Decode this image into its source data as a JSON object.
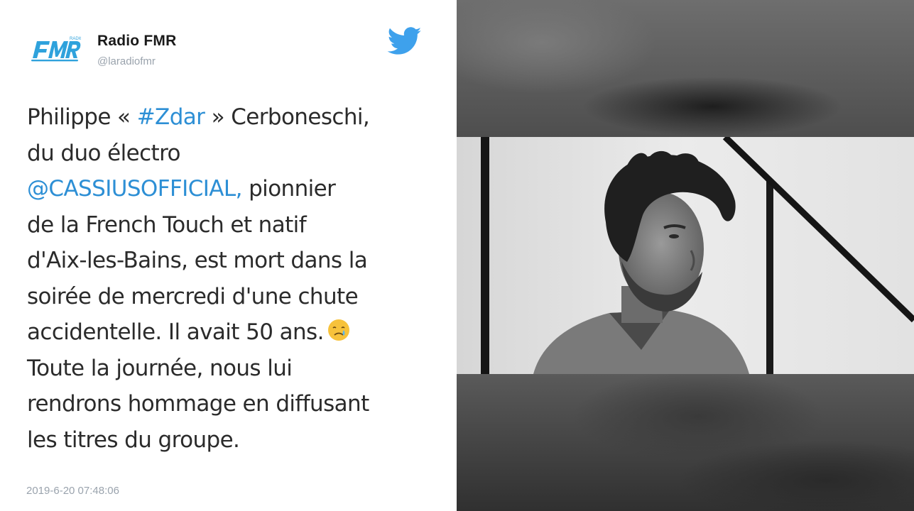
{
  "tweet": {
    "account_name": "Radio FMR",
    "handle": "@laradiofmr",
    "logo_text": "FMR",
    "text_parts": [
      {
        "text": "Philippe « ",
        "link": false
      },
      {
        "text": "#Zdar",
        "link": true
      },
      {
        "text": " » Cerboneschi,\ndu duo électro\n",
        "link": false
      },
      {
        "text": "@CASSIUSOFFICIAL,",
        "link": true
      },
      {
        "text": " pionnier\nde la French Touch et natif\nd'Aix-les-Bains, est mort dans la\nsoirée de mercredi d'une chute\naccidentelle. Il avait 50 ans.",
        "link": false
      }
    ],
    "text_after_emoji": "\nToute la journée, nous lui\nrendrons hommage en diffusant\nles titres du groupe.",
    "emoji": "crying-face",
    "timestamp": "2019-6-20 07:48:06"
  },
  "icons": {
    "bird": "twitter-bird-icon",
    "logo": "radio-fmr-logo"
  },
  "colors": {
    "link": "#2d8fd5",
    "bird": "#3ea1ec",
    "logo": "#2fa2dc",
    "muted": "#9aa3ad"
  },
  "photo": {
    "description_visible": false
  }
}
